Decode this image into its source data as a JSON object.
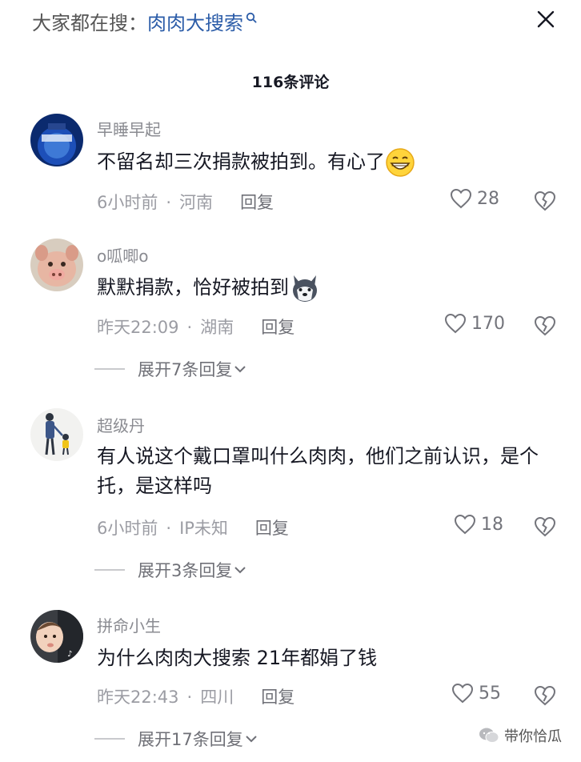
{
  "header": {
    "search_prefix": "大家都在搜：",
    "search_term": "肉肉大搜索",
    "comment_count": "116条评论"
  },
  "comments": [
    {
      "username": "早睡早起",
      "text": "不留名却三次捐款被拍到。有心了",
      "time": "6小时前",
      "location": "河南",
      "reply": "回复",
      "likes": "28",
      "expand": ""
    },
    {
      "username": "o呱唧o",
      "text": "默默捐款，恰好被拍到",
      "time": "昨天22:09",
      "location": "湖南",
      "reply": "回复",
      "likes": "170",
      "expand": "展开7条回复"
    },
    {
      "username": "超级丹",
      "text": "有人说这个戴口罩叫什么肉肉，他们之前认识，是个托，是这样吗",
      "time": "6小时前",
      "location": "IP未知",
      "reply": "回复",
      "likes": "18",
      "expand": "展开3条回复"
    },
    {
      "username": "拼命小生",
      "text": "为什么肉肉大搜索 21年都娟了钱",
      "time": "昨天22:43",
      "location": "四川",
      "reply": "回复",
      "likes": "55",
      "expand": "展开17条回复"
    }
  ],
  "watermark": {
    "text": "带你恰瓜"
  },
  "colors": {
    "search_term": "#2b5ca8",
    "secondary_text": "#9b9ca3",
    "primary_text": "#161823"
  }
}
